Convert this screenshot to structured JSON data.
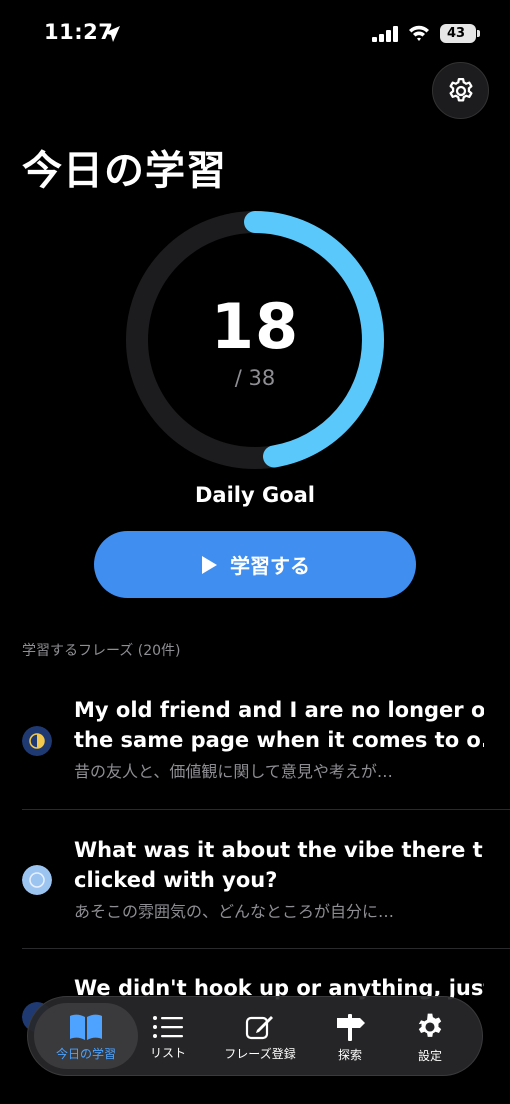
{
  "status": {
    "time": "11:27",
    "battery": "43"
  },
  "title": "今日の学習",
  "goal": {
    "count": "18",
    "total": "/ 38",
    "label": "Daily Goal",
    "progress": 0.474
  },
  "study_button": "学習する",
  "section_header": "学習するフレーズ (20件)",
  "phrases": [
    {
      "title_line1": "My old friend and I are no longer on",
      "title_line2": "the same page when it comes to o...",
      "subtitle": "昔の友人と、価値観に関して意見や考えが…",
      "icon_color": "#f2c94c",
      "icon_bg": "#1f3a73"
    },
    {
      "title_line1": "What was it about the vibe there that",
      "title_line2": "clicked with you?",
      "subtitle": "あそこの雰囲気の、どんなところが自分に…",
      "icon_color": "#e8f0ff",
      "icon_bg": "#9cc4f0"
    },
    {
      "title_line1": "We didn't hook up or anything, just",
      "title_line2": "",
      "subtitle": "",
      "icon_color": "#3f8ef0",
      "icon_bg": "#1f3a73"
    }
  ],
  "tabs": [
    {
      "label": "今日の学習",
      "icon": "book-icon",
      "active": true
    },
    {
      "label": "リスト",
      "icon": "list-icon",
      "active": false
    },
    {
      "label": "フレーズ登録",
      "icon": "edit-icon",
      "active": false
    },
    {
      "label": "探索",
      "icon": "signpost-icon",
      "active": false
    },
    {
      "label": "設定",
      "icon": "gear-icon",
      "active": false
    }
  ],
  "colors": {
    "accent": "#3f8ef0",
    "ring": "#5ac8fa",
    "ring_track": "#1c1c1e"
  }
}
